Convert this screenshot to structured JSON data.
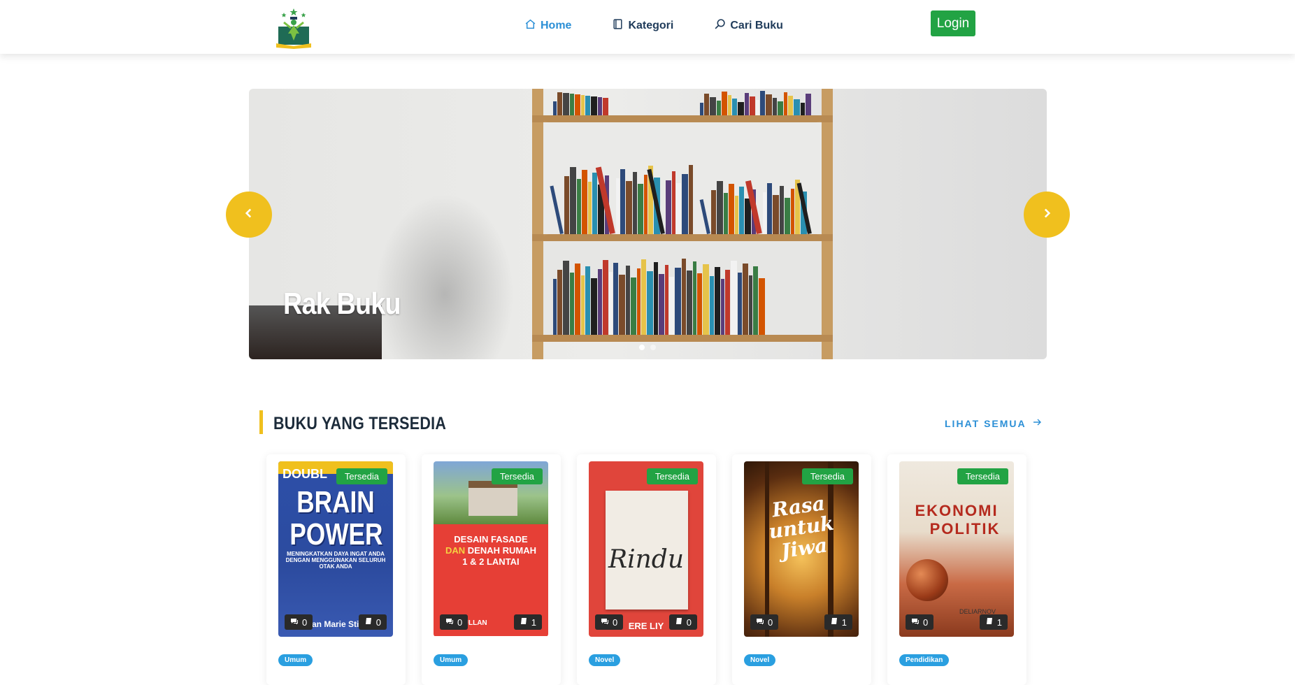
{
  "nav": {
    "logo_name": "library-logo",
    "links": [
      {
        "label": "Home",
        "icon": "home-icon",
        "active": true
      },
      {
        "label": "Kategori",
        "icon": "book-icon",
        "active": false
      },
      {
        "label": "Cari Buku",
        "icon": "search-icon",
        "active": false
      }
    ],
    "login_label": "Login"
  },
  "hero": {
    "caption": "Rak Buku",
    "slide_count": 2,
    "active_slide": 1,
    "prev_icon": "chevron-left-icon",
    "next_icon": "chevron-right-icon"
  },
  "section": {
    "title": "BUKU YANG TERSEDIA",
    "see_all": "LIHAT SEMUA"
  },
  "books": [
    {
      "status": "Tersedia",
      "comments": "0",
      "copies": "0",
      "category": "Umum",
      "cover_lines": [
        "DOUBL",
        "BRAIN",
        "POWER",
        "MENINGKATKAN DAYA INGAT ANDA DENGAN MENGGUNAKAN SELURUH OTAK ANDA",
        "Jean Marie Stine"
      ]
    },
    {
      "status": "Tersedia",
      "comments": "0",
      "copies": "1",
      "category": "Umum",
      "cover_lines": [
        "DESAIN FASADE",
        "DAN",
        "DENAH RUMAH",
        "1 & 2 LANTAI",
        "MANULLAN"
      ]
    },
    {
      "status": "Tersedia",
      "comments": "0",
      "copies": "0",
      "category": "Novel",
      "cover_lines": [
        "Rindu",
        "ERE LIY"
      ]
    },
    {
      "status": "Tersedia",
      "comments": "0",
      "copies": "1",
      "category": "Novel",
      "cover_lines": [
        "Rasa untuk Jiwa"
      ]
    },
    {
      "status": "Tersedia",
      "comments": "0",
      "copies": "1",
      "category": "Pendidikan",
      "cover_lines": [
        "EKONOMI",
        "POLITIK",
        "DELIARNOV"
      ]
    }
  ],
  "colors": {
    "accent": "#f0c01e",
    "link": "#2b8fd6",
    "success": "#22a344",
    "pill": "#2a9fe0"
  }
}
